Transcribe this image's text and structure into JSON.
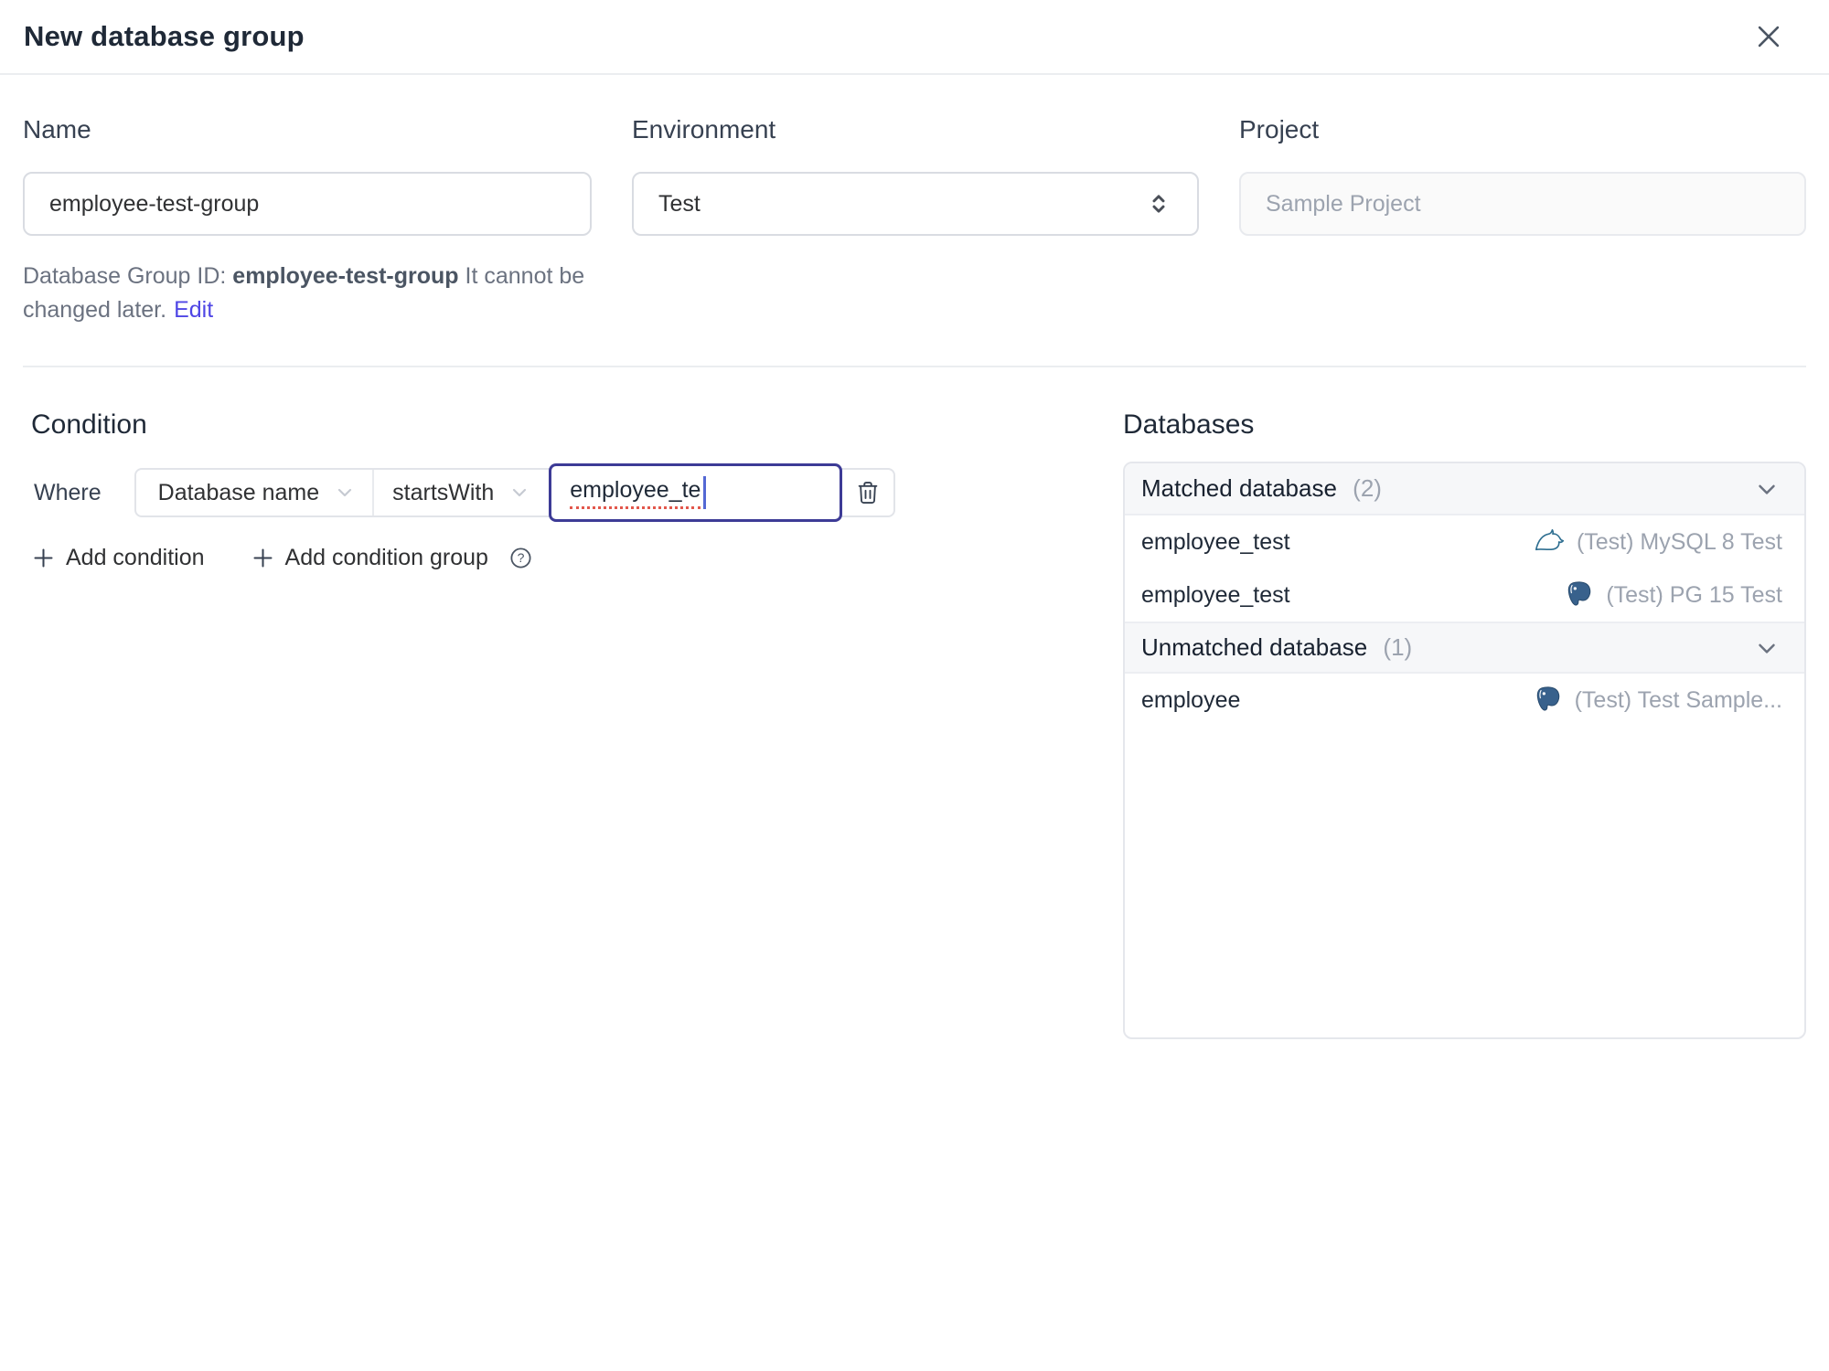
{
  "dialog": {
    "title": "New database group"
  },
  "form": {
    "name": {
      "label": "Name",
      "value": "employee-test-group"
    },
    "environment": {
      "label": "Environment",
      "value": "Test"
    },
    "project": {
      "label": "Project",
      "value": "Sample Project"
    },
    "id_hint": {
      "prefix": "Database Group ID:",
      "id": "employee-test-group",
      "suffix": "It cannot be changed later.",
      "edit_label": "Edit"
    }
  },
  "condition": {
    "heading": "Condition",
    "where_label": "Where",
    "field": "Database name",
    "operator": "startsWith",
    "value": "employee_te",
    "add_condition": "Add condition",
    "add_condition_group": "Add condition group"
  },
  "databases": {
    "heading": "Databases",
    "sections": [
      {
        "title": "Matched database",
        "count": "(2)",
        "rows": [
          {
            "name": "employee_test",
            "engine": "mysql-icon",
            "instance": "(Test) MySQL 8 Test"
          },
          {
            "name": "employee_test",
            "engine": "postgresql-icon",
            "instance": "(Test) PG 15 Test"
          }
        ]
      },
      {
        "title": "Unmatched database",
        "count": "(1)",
        "rows": [
          {
            "name": "employee",
            "engine": "postgresql-icon",
            "instance": "(Test) Test Sample..."
          }
        ]
      }
    ]
  },
  "colors": {
    "accent": "#4f46e5",
    "focus_border": "#3d3b96",
    "spellcheck_red": "#e2574c",
    "mysql_teal": "#2f6f91",
    "postgres_blue": "#38618c",
    "muted_text": "#9ca3af",
    "header_bg": "#f6f7f9"
  }
}
